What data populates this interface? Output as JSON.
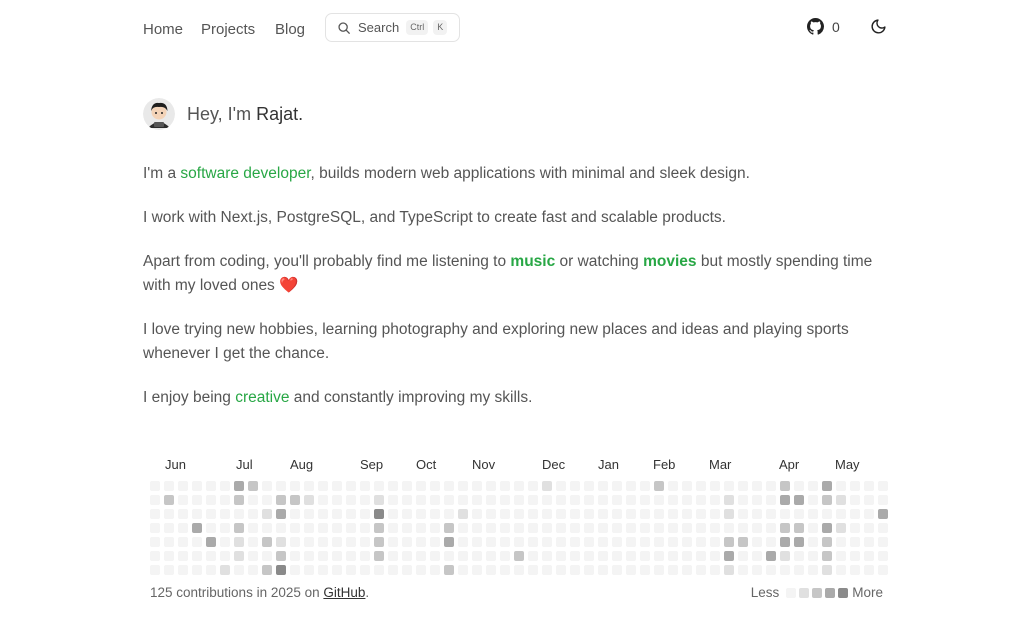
{
  "nav": {
    "links": [
      "Home",
      "Projects",
      "Blog"
    ],
    "search_label": "Search",
    "kbd_ctrl": "Ctrl",
    "kbd_k": "K",
    "github_count": "0"
  },
  "intro": {
    "greeting": "Hey, I'm ",
    "name": "Rajat."
  },
  "bio": {
    "p1_a": "I'm a ",
    "p1_link": "software developer",
    "p1_b": ", builds modern web applications with minimal and sleek design.",
    "p2": "I work with Next.js, PostgreSQL, and TypeScript to create fast and scalable products.",
    "p3_a": "Apart from coding, you'll probably find me listening to ",
    "p3_music": "music",
    "p3_b": " or watching ",
    "p3_movies": "movies",
    "p3_c": " but mostly spending time with my loved ones ",
    "p3_emoji": "❤️",
    "p4": "I love trying new hobbies, learning photography and exploring new places and ideas and playing sports whenever I get the chance.",
    "p5_a": "I enjoy being ",
    "p5_link": "creative",
    "p5_b": " and constantly improving my skills."
  },
  "contributions": {
    "months": [
      "Jun",
      "Jul",
      "Aug",
      "Sep",
      "Oct",
      "Nov",
      "Dec",
      "Jan",
      "Feb",
      "Mar",
      "Apr",
      "May"
    ],
    "summary_a": "125 contributions in 2025 on ",
    "summary_link": "GitHub",
    "summary_b": ".",
    "legend_less": "Less",
    "legend_more": "More",
    "level_colors": [
      "#f4f4f4",
      "#e0e0e0",
      "#c6c6c6",
      "#aaaaaa",
      "#8a8a8a"
    ],
    "weeks": 53,
    "cells": [
      [
        6,
        0,
        3
      ],
      [
        6,
        1,
        2
      ],
      [
        6,
        3,
        2
      ],
      [
        6,
        4,
        1
      ],
      [
        6,
        5,
        1
      ],
      [
        7,
        0,
        2
      ],
      [
        1,
        1,
        2
      ],
      [
        3,
        3,
        3
      ],
      [
        4,
        4,
        3
      ],
      [
        5,
        6,
        1
      ],
      [
        8,
        2,
        1
      ],
      [
        8,
        4,
        2
      ],
      [
        8,
        6,
        2
      ],
      [
        9,
        1,
        2
      ],
      [
        9,
        2,
        3
      ],
      [
        9,
        4,
        1
      ],
      [
        9,
        5,
        2
      ],
      [
        9,
        6,
        4
      ],
      [
        10,
        1,
        2
      ],
      [
        11,
        1,
        1
      ],
      [
        16,
        2,
        4
      ],
      [
        16,
        3,
        2
      ],
      [
        16,
        4,
        2
      ],
      [
        16,
        5,
        2
      ],
      [
        16,
        1,
        1
      ],
      [
        21,
        3,
        2
      ],
      [
        21,
        4,
        3
      ],
      [
        21,
        6,
        2
      ],
      [
        22,
        2,
        1
      ],
      [
        26,
        5,
        2
      ],
      [
        28,
        0,
        1
      ],
      [
        36,
        0,
        2
      ],
      [
        41,
        1,
        1
      ],
      [
        41,
        2,
        1
      ],
      [
        41,
        4,
        2
      ],
      [
        41,
        5,
        3
      ],
      [
        41,
        6,
        1
      ],
      [
        42,
        4,
        2
      ],
      [
        44,
        5,
        3
      ],
      [
        45,
        0,
        2
      ],
      [
        45,
        1,
        3
      ],
      [
        45,
        3,
        2
      ],
      [
        45,
        4,
        3
      ],
      [
        45,
        5,
        1
      ],
      [
        46,
        1,
        3
      ],
      [
        46,
        3,
        2
      ],
      [
        46,
        4,
        3
      ],
      [
        48,
        0,
        3
      ],
      [
        48,
        1,
        2
      ],
      [
        48,
        3,
        3
      ],
      [
        48,
        4,
        2
      ],
      [
        48,
        5,
        2
      ],
      [
        48,
        6,
        1
      ],
      [
        49,
        1,
        1
      ],
      [
        49,
        3,
        1
      ],
      [
        52,
        2,
        3
      ]
    ]
  }
}
